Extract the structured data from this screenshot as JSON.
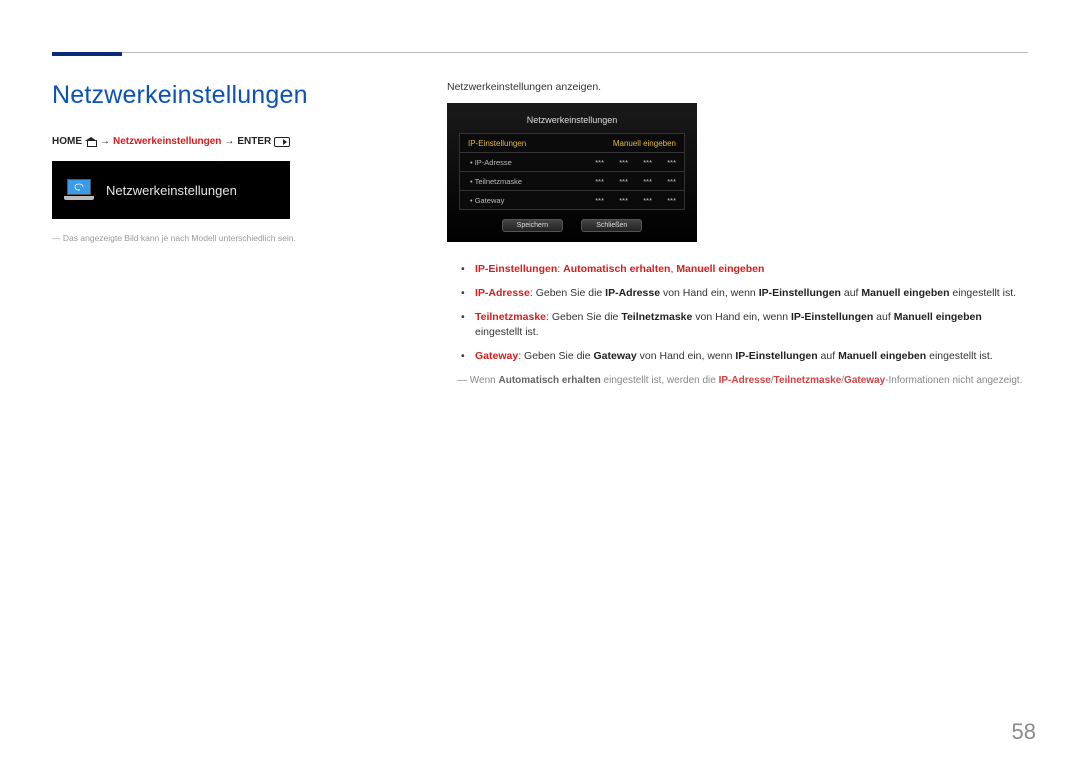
{
  "page_number": "58",
  "title": "Netzwerkeinstellungen",
  "breadcrumb": {
    "home": "HOME",
    "item": "Netzwerkeinstellungen",
    "enter": "ENTER",
    "arrow": "→"
  },
  "menu_card": {
    "label": "Netzwerkeinstellungen"
  },
  "footnote_left": "Das angezeigte Bild kann je nach Modell unterschiedlich sein.",
  "intro": "Netzwerkeinstellungen anzeigen.",
  "panel": {
    "title": "Netzwerkeinstellungen",
    "header_label": "IP-Einstellungen",
    "header_value": "Manuell eingeben",
    "rows": [
      {
        "label": "IP-Adresse",
        "octets": [
          "***",
          "***",
          "***",
          "***"
        ]
      },
      {
        "label": "Teilnetzmaske",
        "octets": [
          "***",
          "***",
          "***",
          "***"
        ]
      },
      {
        "label": "Gateway",
        "octets": [
          "***",
          "***",
          "***",
          "***"
        ]
      }
    ],
    "btn_save": "Speichern",
    "btn_close": "Schließen"
  },
  "bullets": {
    "b1_red": "IP-Einstellungen",
    "b1_sep": ": ",
    "b1_opt1": "Automatisch erhalten",
    "b1_comma": ", ",
    "b1_opt2": "Manuell eingeben",
    "b2_label": "IP-Adresse",
    "b2_t1": ": Geben Sie die ",
    "b2_r1": "IP-Adresse",
    "b2_t2": " von Hand ein, wenn ",
    "b2_r2": "IP-Einstellungen",
    "b2_t3": " auf ",
    "b2_r3": "Manuell eingeben",
    "b2_t4": " eingestellt ist.",
    "b3_label": "Teilnetzmaske",
    "b3_t1": ": Geben Sie die ",
    "b3_r1": "Teilnetzmaske",
    "b3_t2": " von Hand ein, wenn ",
    "b3_r2": "IP-Einstellungen",
    "b3_t3": " auf ",
    "b3_r3": "Manuell eingeben",
    "b3_t4": " eingestellt ist.",
    "b4_label": "Gateway",
    "b4_t1": ": Geben Sie die ",
    "b4_r1": "Gateway",
    "b4_t2": " von Hand ein, wenn ",
    "b4_r2": "IP-Einstellungen",
    "b4_t3": " auf ",
    "b4_r3": "Manuell eingeben",
    "b4_t4": " eingestellt ist."
  },
  "note": {
    "t1": "Wenn ",
    "b1": "Automatisch erhalten",
    "t2": " eingestellt ist, werden die ",
    "r1": "IP-Adresse",
    "sep": "/",
    "r2": "Teilnetzmaske",
    "r3": "Gateway",
    "t3": "-Informationen nicht angezeigt."
  }
}
